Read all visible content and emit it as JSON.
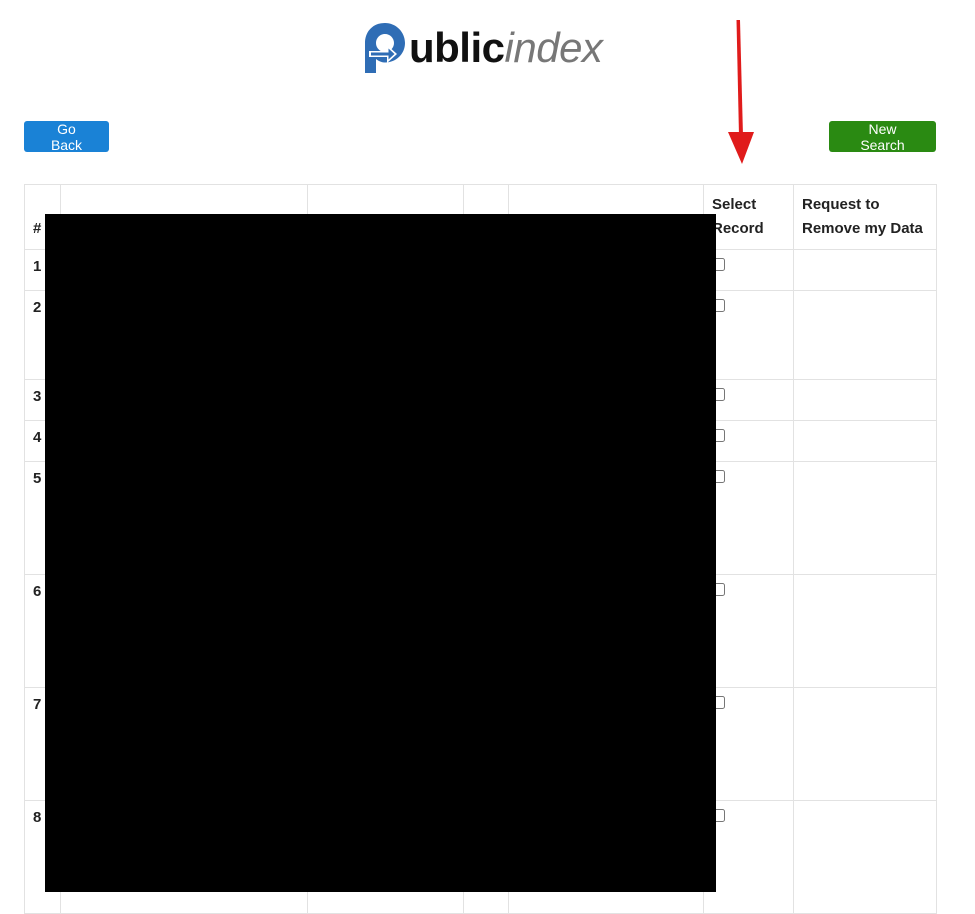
{
  "logo": {
    "bold": "ublic",
    "light": "index"
  },
  "header": {
    "back_label": "Go Back",
    "new_search_label": "New Search"
  },
  "table": {
    "columns": [
      "#",
      "",
      "",
      "",
      "",
      "Select Record",
      "Request to Remove my Data"
    ],
    "rows": [
      {
        "index": "1"
      },
      {
        "index": "2"
      },
      {
        "index": "3"
      },
      {
        "index": "4"
      },
      {
        "index": "5"
      },
      {
        "index": "6"
      },
      {
        "index": "7"
      },
      {
        "index": "8"
      }
    ]
  },
  "colors": {
    "logo_blue": "#2f6db5",
    "go_back_button": "#1a82d6",
    "new_search_button": "#2a8a12",
    "annotation_arrow": "#e01b1b",
    "redaction": "#000000"
  }
}
